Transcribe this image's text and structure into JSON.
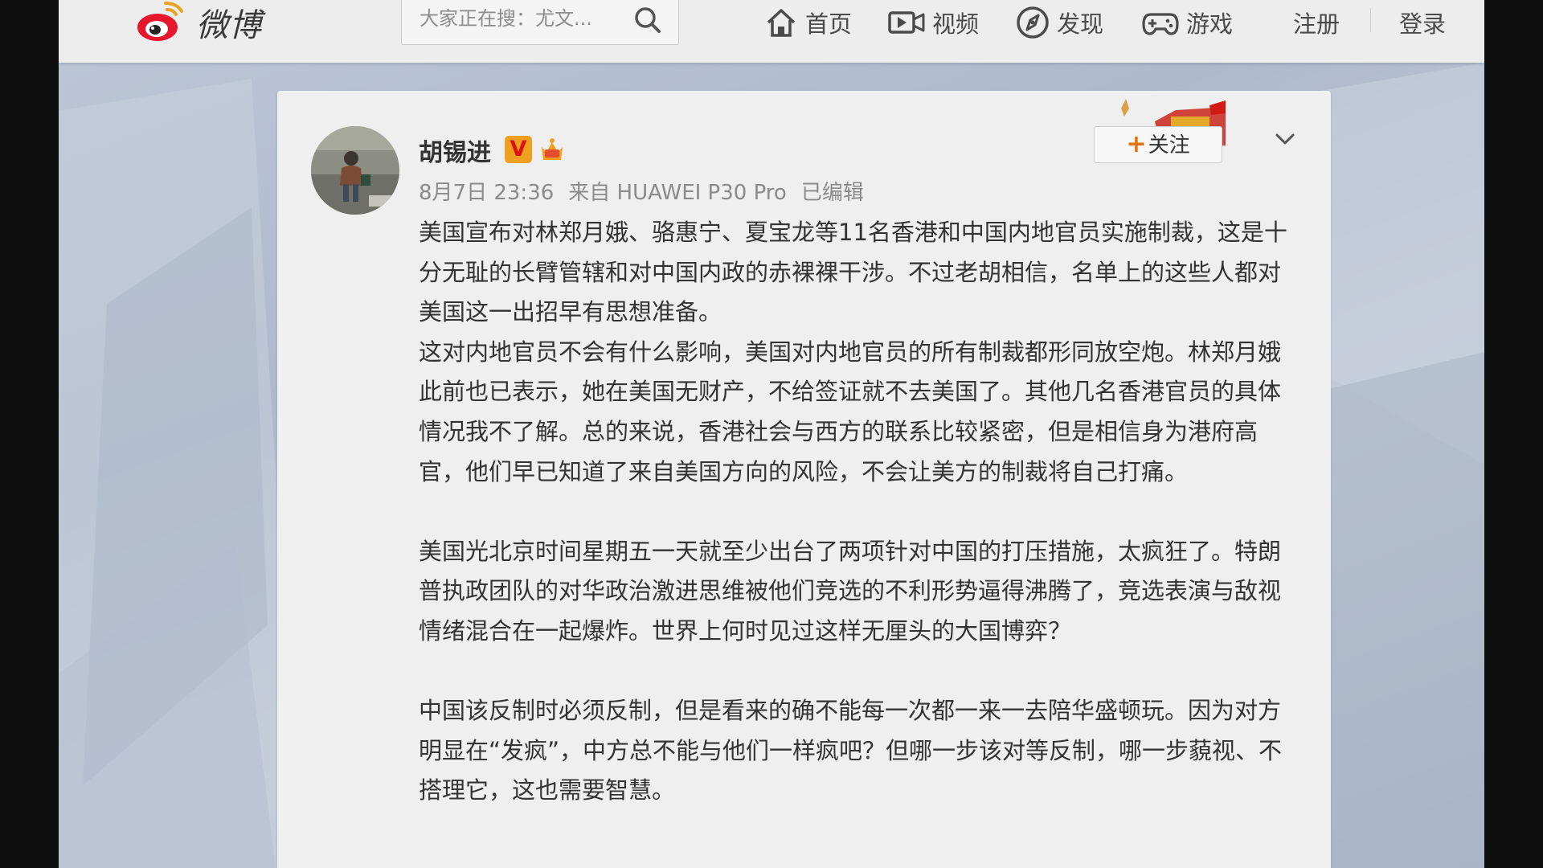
{
  "topbar": {
    "logo_text": "微博",
    "search_placeholder": "大家正在搜：尤文...",
    "nav": [
      {
        "label": "首页",
        "icon": "home-icon"
      },
      {
        "label": "视频",
        "icon": "video-icon"
      },
      {
        "label": "发现",
        "icon": "compass-icon"
      },
      {
        "label": "游戏",
        "icon": "gamepad-icon"
      }
    ],
    "register_label": "注册",
    "login_label": "登录"
  },
  "post": {
    "author": "胡锡进",
    "verified_badge": "V",
    "timestamp": "8月7日 23:36",
    "source": "来自 HUAWEI P30 Pro",
    "edited_label": "已编辑",
    "follow_label": "关注",
    "paragraphs": [
      "美国宣布对林郑月娥、骆惠宁、夏宝龙等11名香港和中国内地官员实施制裁，这是十分无耻的长臂管辖和对中国内政的赤裸裸干涉。不过老胡相信，名单上的这些人都对美国这一出招早有思想准备。",
      "这对内地官员不会有什么影响，美国对内地官员的所有制裁都形同放空炮。林郑月娥此前也已表示，她在美国无财产，不给签证就不去美国了。其他几名香港官员的具体情况我不了解。总的来说，香港社会与西方的联系比较紧密，但是相信身为港府高官，他们早已知道了来自美国方向的风险，不会让美方的制裁将自己打痛。",
      "",
      "美国光北京时间星期五一天就至少出台了两项针对中国的打压措施，太疯狂了。特朗普执政团队的对华政治激进思维被他们竞选的不利形势逼得沸腾了，竞选表演与敌视情绪混合在一起爆炸。世界上何时见过这样无厘头的大国博弈？",
      "",
      "中国该反制时必须反制，但是看来的确不能每一次都一来一去陪华盛顿玩。因为对方明显在“发疯”，中方总不能与他们一样疯吧？但哪一步该对等反制，哪一步藐视、不搭理它，这也需要智慧。"
    ]
  },
  "colors": {
    "weibo_red": "#e6162d",
    "follow_plus": "#e8710a",
    "vip_badge": "#f0a020",
    "page_bg": "#b8c2d4"
  }
}
